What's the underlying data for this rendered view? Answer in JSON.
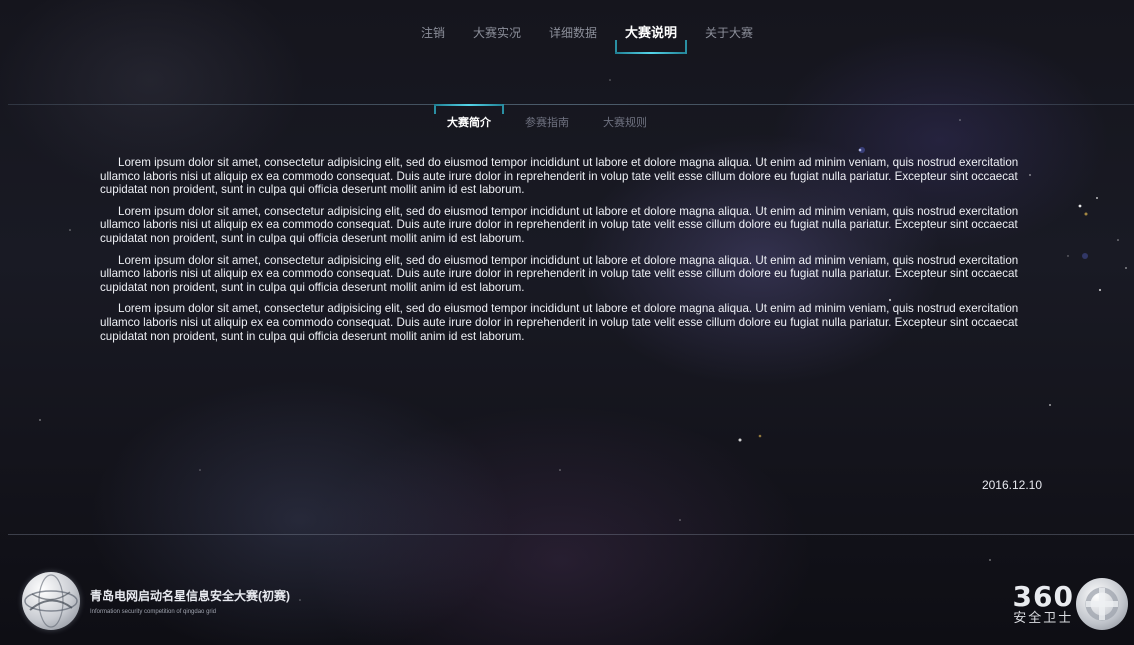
{
  "nav": {
    "items": [
      {
        "label": "注销"
      },
      {
        "label": "大赛实况"
      },
      {
        "label": "详细数据"
      },
      {
        "label": "大赛说明"
      },
      {
        "label": "关于大赛"
      }
    ],
    "active_index": 3
  },
  "sub_tabs": {
    "items": [
      {
        "label": "大赛简介"
      },
      {
        "label": "参赛指南"
      },
      {
        "label": "大赛规则"
      }
    ],
    "active_index": 0
  },
  "content": {
    "paragraphs": [
      "Lorem ipsum dolor sit amet, consectetur adipisicing elit, sed do eiusmod tempor incididunt ut labore et dolore magna aliqua. Ut enim ad minim veniam, quis nostrud exercitation ullamco laboris nisi ut aliquip ex ea commodo consequat. Duis aute irure dolor in reprehenderit in volup tate velit esse cillum dolore eu fugiat nulla pariatur. Excepteur sint occaecat cupidatat non proident, sunt in culpa qui officia deserunt mollit anim id est laborum.",
      "Lorem ipsum dolor sit amet, consectetur adipisicing elit, sed do eiusmod tempor incididunt ut labore et dolore magna aliqua. Ut enim ad minim veniam, quis nostrud exercitation ullamco laboris nisi ut aliquip ex ea commodo consequat. Duis aute irure dolor in reprehenderit in volup tate velit esse cillum dolore eu fugiat nulla pariatur. Excepteur sint occaecat cupidatat non proident, sunt in culpa qui officia deserunt mollit anim id est laborum.",
      "Lorem ipsum dolor sit amet, consectetur adipisicing elit, sed do eiusmod tempor incididunt ut labore et dolore magna aliqua. Ut enim ad minim veniam, quis nostrud exercitation ullamco laboris nisi ut aliquip ex ea commodo consequat. Duis aute irure dolor in reprehenderit in volup tate velit esse cillum dolore eu fugiat nulla pariatur. Excepteur sint occaecat cupidatat non proident, sunt in culpa qui officia deserunt mollit anim id est laborum.",
      "Lorem ipsum dolor sit amet, consectetur adipisicing elit, sed do eiusmod tempor incididunt ut labore et dolore magna aliqua. Ut enim ad minim veniam, quis nostrud exercitation ullamco laboris nisi ut aliquip ex ea commodo consequat. Duis aute irure dolor in reprehenderit in volup tate velit esse cillum dolore eu fugiat nulla pariatur. Excepteur sint occaecat cupidatat non proident, sunt in culpa qui officia deserunt mollit anim id est laborum."
    ],
    "date": "2016.12.10"
  },
  "footer": {
    "title": "青岛电网启动名星信息安全大赛(初赛)",
    "subtitle": "Information security competition of qingdao grid",
    "brand_number": "360",
    "brand_name": "安全卫士"
  },
  "icons": {
    "org_logo": "globe-logo-icon",
    "brand_logo": "360-ball-icon"
  },
  "colors": {
    "accent": "#55d6ea",
    "accent_dark": "#2a8fa3",
    "text": "#eef0f5",
    "muted": "#8c8f9a"
  }
}
